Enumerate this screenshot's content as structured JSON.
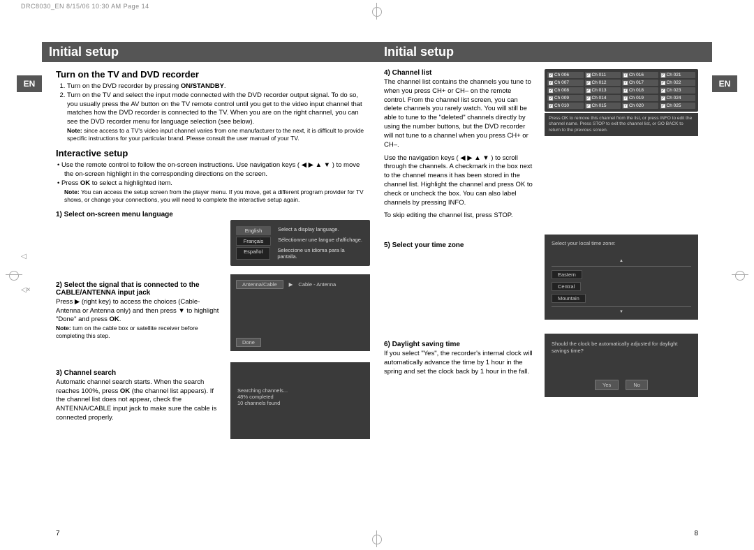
{
  "header": {
    "stamp": "DRC8030_EN  8/15/06  10:30 AM  Page 14"
  },
  "lang_tab": "EN",
  "page_left": {
    "title": "Initial setup",
    "section1": {
      "heading": "Turn on the TV and DVD recorder",
      "item1_a": "Turn on the DVD recorder by pressing ",
      "item1_b": "ON/STANDBY",
      "item1_c": ".",
      "item2": "Turn on the TV and select the input mode connected with the DVD recorder output signal. To do so, you usually press the AV button on the TV remote control until you get to the video input channel that matches how the DVD recorder is connected to the TV.  When you are on the right channel, you can see the DVD recorder menu for language selection (see below).",
      "note_label": "Note:",
      "note": " since access to a TV's video input channel varies from one manufacturer to the next, it is difficult to provide specific instructions for your particular brand. Please consult the user manual of your TV."
    },
    "section2": {
      "heading": "Interactive setup",
      "bullet1": "Use the remote control to follow the on-screen instructions. Use navigation keys ( ◀ ▶ ▲ ▼ ) to move the on-screen highlight in the corresponding directions on the screen.",
      "bullet2a": "Press ",
      "bullet2b": "OK",
      "bullet2c": " to select a highlighted item.",
      "note_label": "Note:",
      "note": " You can access the setup screen from the player menu. If you move, get a different program provider for TV shows, or change your connections, you will need to complete the interactive setup again."
    },
    "step1": {
      "heading": "1) Select on-screen menu language",
      "lang_rows": [
        {
          "btn": "English",
          "desc": "Select a display language."
        },
        {
          "btn": "Français",
          "desc": "Sélectionner une langue d'affichage."
        },
        {
          "btn": "Español",
          "desc": "Seleccione un idioma para la pantalla."
        }
      ]
    },
    "step2": {
      "heading": "2) Select the signal that is connected to the CABLE/ANTENNA input jack",
      "body_a": "Press ▶ (right key) to access the choices (Cable-Antenna or Antenna only) and then press ▼ to highlight \"Done\" and press ",
      "body_b": "OK",
      "body_c": ".",
      "note_label": "Note:",
      "note": " turn on the cable box or satellite receiver before completing this step.",
      "sig_label": "Antenna/Cable",
      "sig_value": "Cable - Antenna",
      "done": "Done"
    },
    "step3": {
      "heading": "3) Channel search",
      "body_a": "Automatic channel search starts. When the search reaches 100%, press ",
      "body_b": "OK",
      "body_c": " (the channel list appears). If the channel list does not appear, check the ANTENNA/CABLE input jack to make sure the cable is connected properly.",
      "srch1": "Searching channels...",
      "srch2": "48% completed",
      "srch3": "10 channels found"
    },
    "page_num": "7"
  },
  "page_right": {
    "title": "Initial setup",
    "step4": {
      "heading": "4) Channel list",
      "p1": "The channel list contains the channels you tune to when you press CH+ or CH– on the remote control. From the channel list screen, you can delete channels you rarely watch. You will still be able to tune to the \"deleted\" channels directly by using the number buttons, but the DVD recorder will not tune to a channel when you press CH+ or CH–.",
      "p2": "Use the navigation keys ( ◀ ▶ ▲ ▼ ) to scroll through the channels. A checkmark in the box next to the channel means it has been stored in the channel list. Highlight the channel and press OK to check or uncheck the box. You can also label channels by pressing INFO.",
      "p3": "To skip editing the channel list, press STOP.",
      "channels": [
        [
          "Ch 006",
          "Ch 011",
          "Ch 016",
          "Ch 021"
        ],
        [
          "Ch 007",
          "Ch 012",
          "Ch 017",
          "Ch 022"
        ],
        [
          "Ch 008",
          "Ch 013",
          "Ch 018",
          "Ch 023"
        ],
        [
          "Ch 009",
          "Ch 014",
          "Ch 019",
          "Ch 024"
        ],
        [
          "Ch 010",
          "Ch 015",
          "Ch 020",
          "Ch 025"
        ]
      ],
      "hint": "Press OK to remove this channel from the list, or press INFO to edit the channel name. Press STOP to exit the channel list, or GO BACK to return to the previous screen."
    },
    "step5": {
      "heading": "5) Select your time zone",
      "title": "Select your local time zone:",
      "opts": [
        "Eastern",
        "Central",
        "Mountain"
      ]
    },
    "step6": {
      "heading": "6) Daylight saving time",
      "body": "If you select \"Yes\", the recorder's internal clock will automatically advance the time by 1 hour in the spring and set the clock back by 1 hour in the fall.",
      "q": "Should the clock be automatically adjusted for daylight savings time?",
      "yes": "Yes",
      "no": "No"
    },
    "page_num": "8"
  }
}
